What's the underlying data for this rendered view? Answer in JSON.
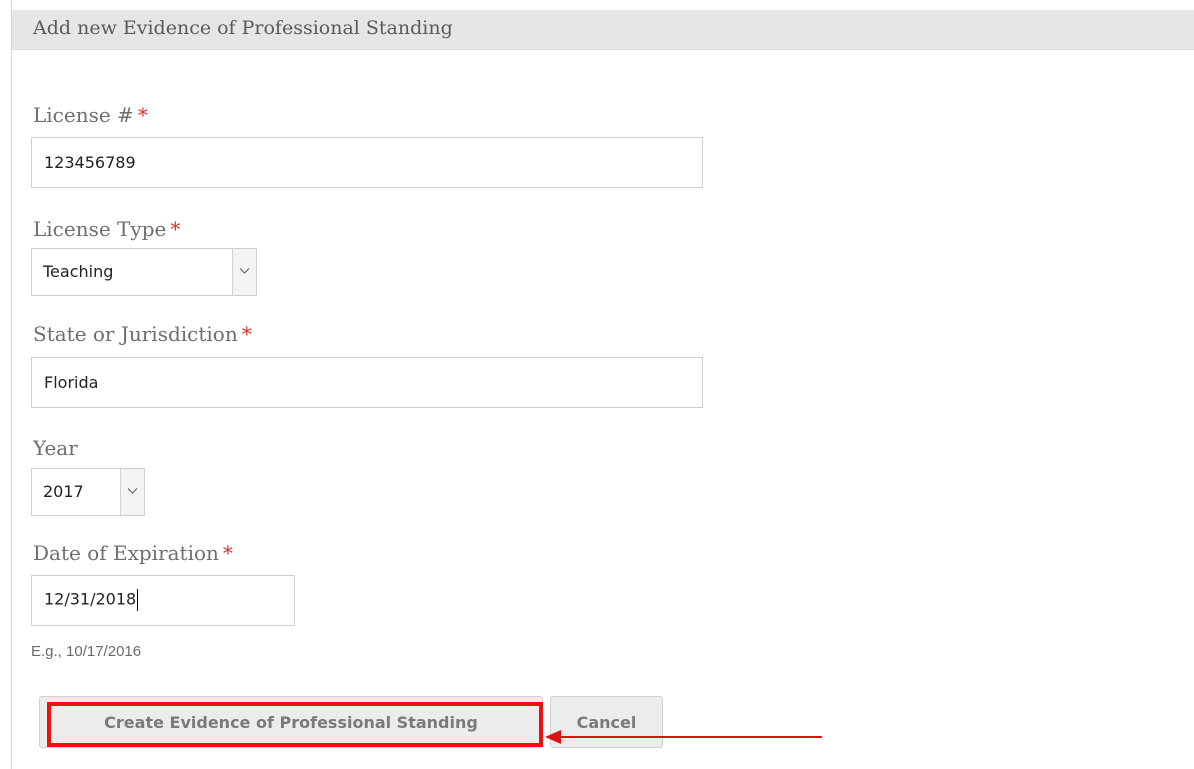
{
  "panel": {
    "title": "Add new Evidence of Professional Standing"
  },
  "form": {
    "license_number": {
      "label": "License #",
      "required_marker": "*",
      "value": "123456789"
    },
    "license_type": {
      "label": "License Type",
      "required_marker": "*",
      "selected": "Teaching"
    },
    "state": {
      "label": "State or Jurisdiction",
      "required_marker": "*",
      "value": "Florida"
    },
    "year": {
      "label": "Year",
      "selected": "2017"
    },
    "expiration": {
      "label": "Date of Expiration",
      "required_marker": "*",
      "value": "12/31/2018",
      "hint": "E.g., 10/17/2016"
    }
  },
  "actions": {
    "create_label": "Create Evidence of Professional Standing",
    "cancel_label": "Cancel"
  },
  "annotation": {
    "highlight_color": "#ee1111",
    "arrow_color": "#dd1111"
  },
  "colors": {
    "required": "#d2322d",
    "header_bg": "#e6e6e6"
  }
}
